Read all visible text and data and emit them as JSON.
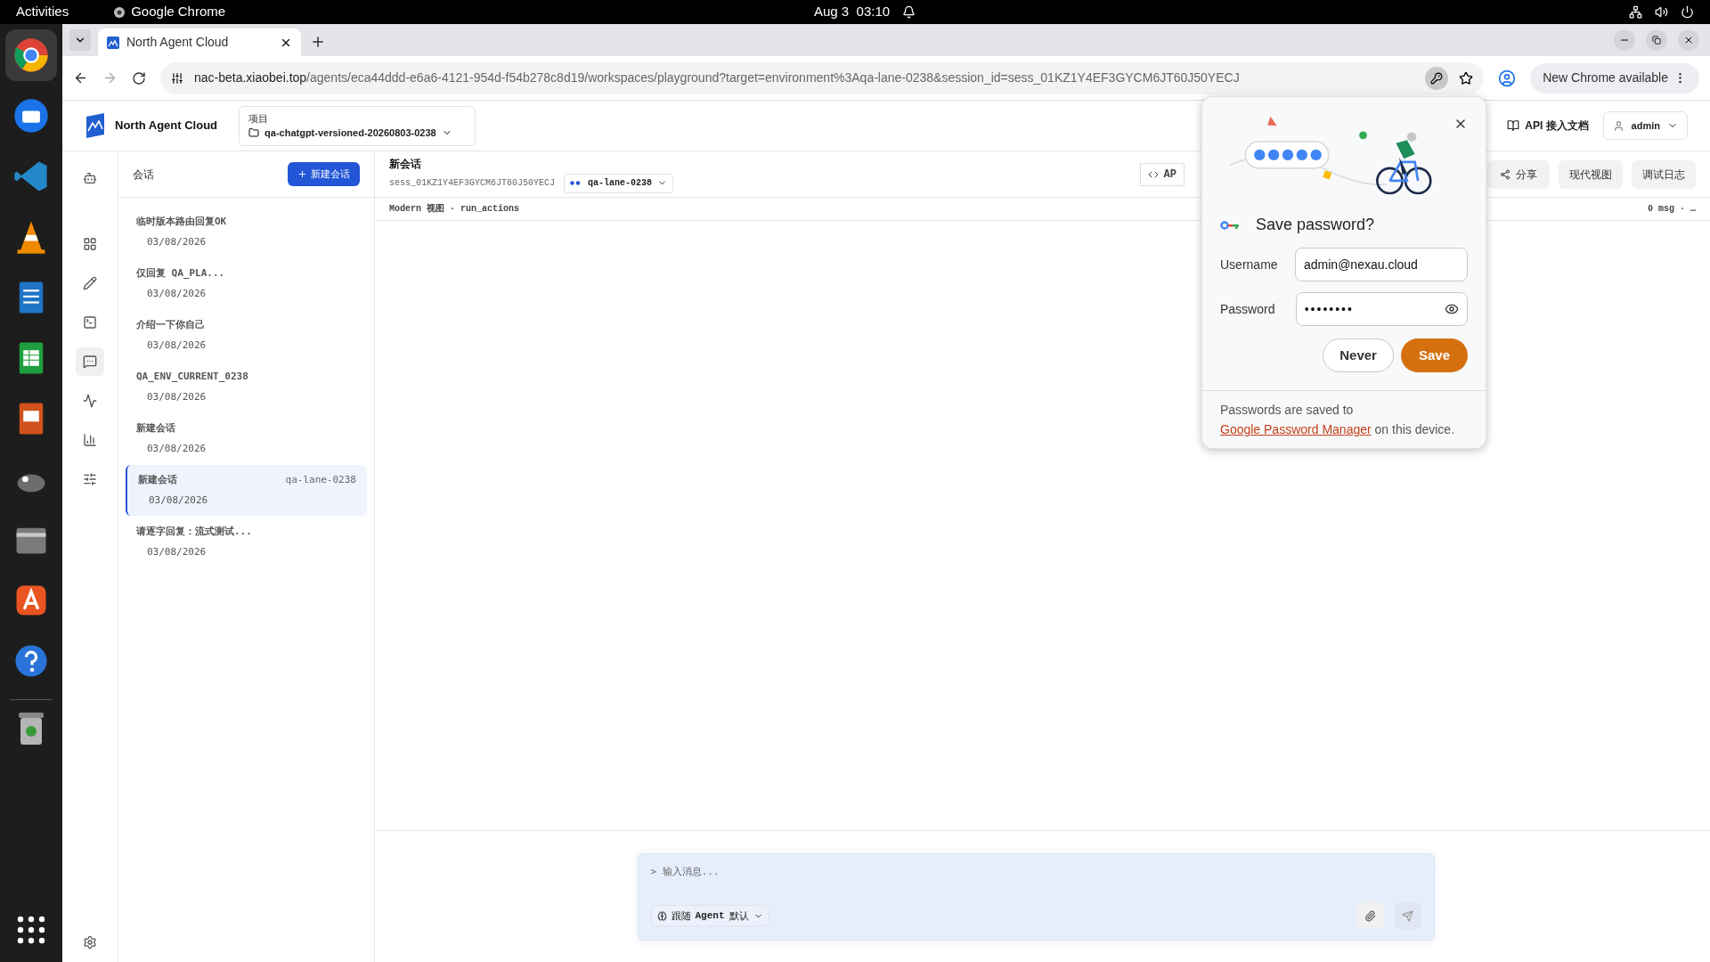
{
  "system_bar": {
    "activities": "Activities",
    "app_name": "Google Chrome",
    "datetime": "Aug 3  03:10"
  },
  "browser": {
    "tab": {
      "title": "North Agent Cloud",
      "selected": true
    },
    "address": {
      "host": "nac-beta.xiaobei.top",
      "path": "/agents/eca44ddd-e6a6-4121-954d-f54b278c8d19/workspaces/playground?target=environment%3Aqa-lane-0238&session_id=sess_01KZ1Y4EF3GYCM6JT60J50YECJ"
    },
    "update_button": "New Chrome available"
  },
  "app_header": {
    "brand": "North Agent Cloud",
    "project_label": "项目",
    "project": "qa-chatgpt-versioned-20260803-0238",
    "docs_link": "API 接入文档",
    "user": "admin"
  },
  "rail_items": [
    {
      "selected": false
    },
    {
      "selected": false
    },
    {
      "selected": false
    },
    {
      "selected": false
    },
    {
      "selected": true
    },
    {
      "selected": false
    },
    {
      "selected": false
    },
    {
      "selected": false
    }
  ],
  "sessions_panel": {
    "title": "会话",
    "new_button": "新建会话",
    "items": [
      {
        "title": "临时版本路由回复OK",
        "date": "03/08/2026",
        "selected": false
      },
      {
        "title": "仅回复 QA_PLA...",
        "date": "03/08/2026",
        "selected": false
      },
      {
        "title": "介绍一下你自己",
        "date": "03/08/2026",
        "selected": false
      },
      {
        "title": "QA_ENV_CURRENT_0238",
        "date": "03/08/2026",
        "selected": false
      },
      {
        "title": "新建会话",
        "date": "03/08/2026",
        "selected": false
      },
      {
        "title": "新建会话",
        "date": "03/08/2026",
        "selected": true,
        "tag": "qa-lane-0238"
      },
      {
        "title": "请逐字回复：流式测试...",
        "date": "03/08/2026",
        "selected": false
      }
    ]
  },
  "chat": {
    "title": "新会话",
    "session_id": "sess_01KZ1Y4EF3GYCM6JT60J50YECJ",
    "lane": "qa-lane-0238",
    "toolbar": [
      {
        "kind": "code",
        "label": "AP"
      },
      {
        "kind": "share",
        "label": "分享"
      },
      {
        "kind": "plain",
        "label": "现代视图"
      },
      {
        "kind": "plain",
        "label": "调试日志"
      }
    ],
    "view_info": "Modern 视图 · run_actions",
    "message_count": "0 msg · …",
    "composer": {
      "placeholder": "> 输入消息...",
      "mode_prefix": "跟随",
      "mode_agent": "Agent",
      "mode_suffix": "默认"
    }
  },
  "password_popup": {
    "title": "Save password?",
    "username_label": "Username",
    "username": "admin@nexau.cloud",
    "password_label": "Password",
    "password": "••••••••",
    "never_button": "Never",
    "save_button": "Save",
    "footer_text": "Passwords are saved to",
    "footer_link": "Google Password Manager",
    "footer_suffix": "on this device."
  }
}
